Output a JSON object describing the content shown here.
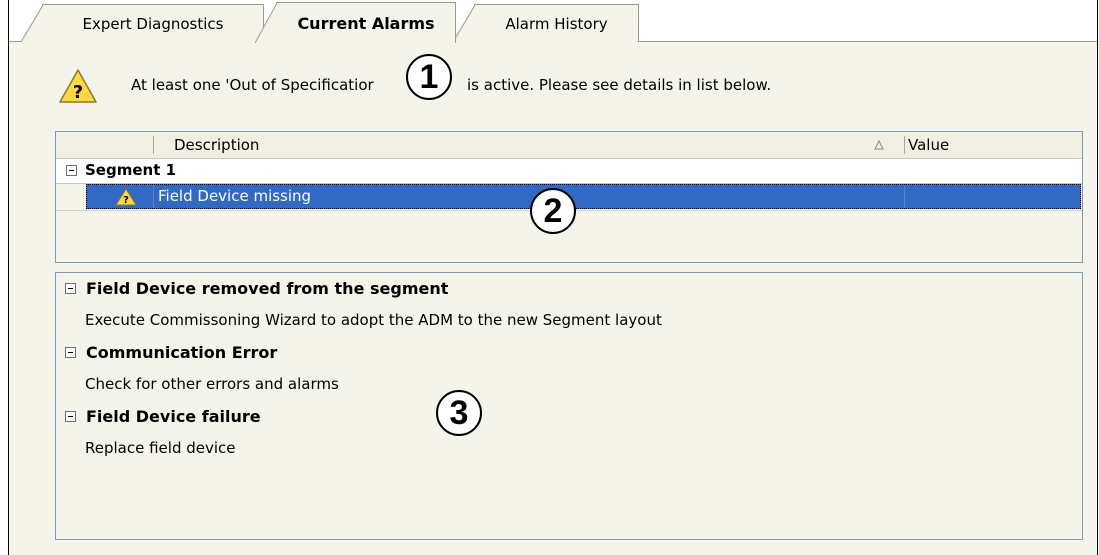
{
  "tabs": [
    {
      "label": "Expert Diagnostics",
      "active": false
    },
    {
      "label": "Current Alarms",
      "active": true
    },
    {
      "label": "Alarm History",
      "active": false
    }
  ],
  "status_message": "At least one 'Out of Specification' alarm is active. Please see details in list below.",
  "status_message_visible_left": "At least one 'Out of Specificatior",
  "status_message_visible_right": "is active. Please see details in list below.",
  "alarm_grid": {
    "columns": [
      "Description",
      "Value"
    ],
    "groups": [
      {
        "label": "Segment 1",
        "rows": [
          {
            "description": "Field Device missing",
            "value": "",
            "selected": true,
            "icon": "warning-icon"
          }
        ]
      }
    ]
  },
  "remedies": [
    {
      "title": "Field Device removed from the segment",
      "text": "Execute Commissoning Wizard to adopt the ADM to the new Segment layout"
    },
    {
      "title": "Communication Error",
      "text": "Check for other errors and alarms"
    },
    {
      "title": "Field Device failure",
      "text": "Replace field device"
    }
  ],
  "callouts": [
    "1",
    "2",
    "3"
  ],
  "colors": {
    "selection": "#316ac5",
    "warning_fill": "#ffd93b",
    "panel_border": "#7a9cb8",
    "panel_bg": "#f5f4ea"
  }
}
